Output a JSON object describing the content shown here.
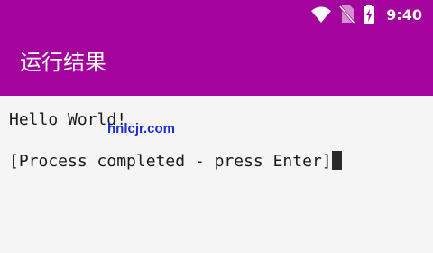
{
  "status_bar": {
    "icons": [
      "wifi-icon",
      "no-sim-icon",
      "battery-charging-icon"
    ],
    "time": "9:40"
  },
  "app_bar": {
    "title": "运行结果",
    "color": "#a3059c"
  },
  "terminal": {
    "lines": [
      "Hello World!",
      "[Process completed - press Enter]"
    ]
  },
  "watermark": {
    "text": "hnlcjr.com"
  }
}
